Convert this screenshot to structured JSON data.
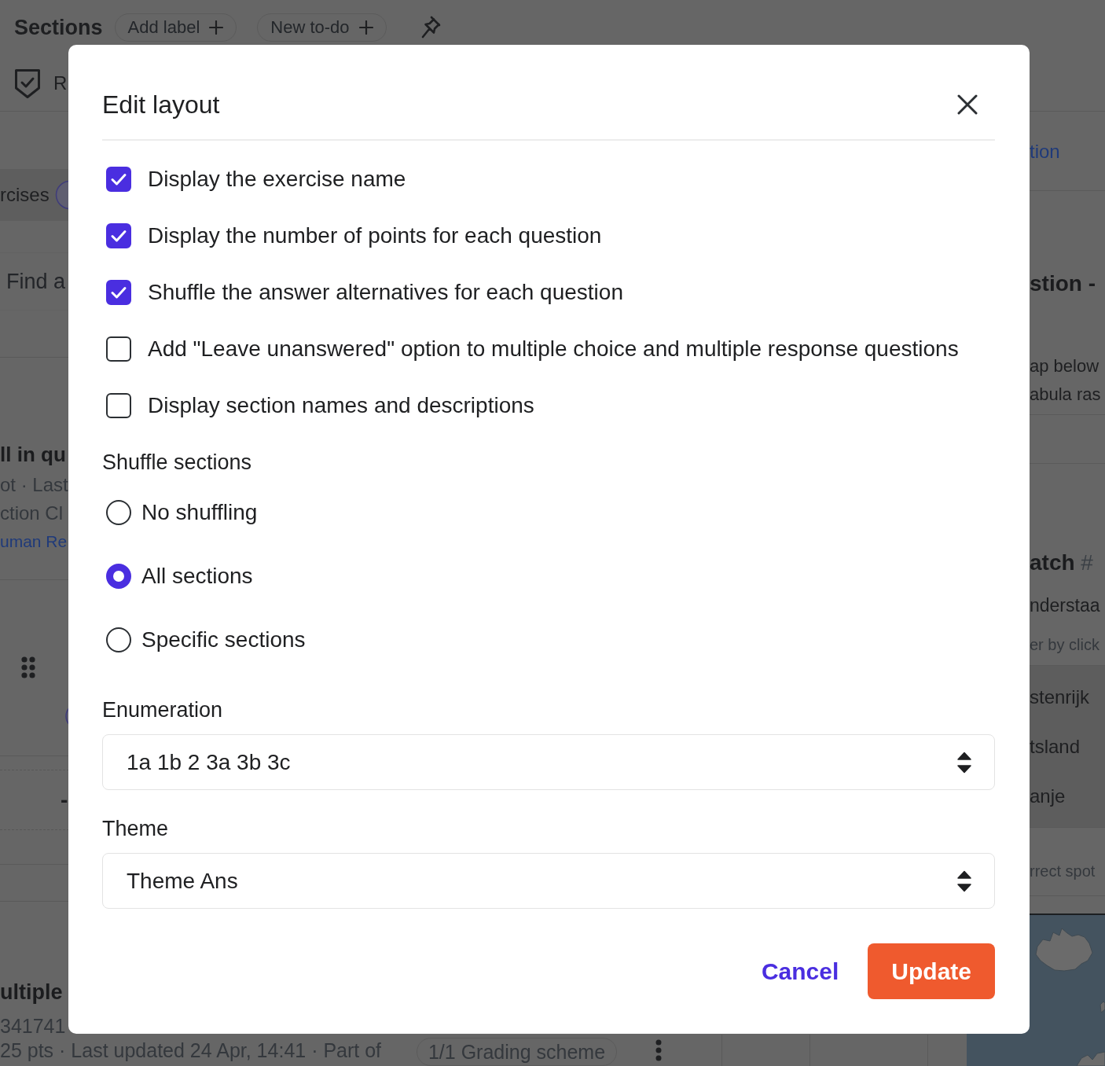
{
  "page": {
    "header": {
      "title": "Sections",
      "buttons": [
        {
          "label": "Add label"
        },
        {
          "label": "New to-do"
        }
      ]
    },
    "subheader": {
      "text": "R"
    },
    "left_panel": {
      "tab_label": "rcises",
      "search": {
        "placeholder": "Find a"
      },
      "item": {
        "title": "ll in qu",
        "meta": "ot · Last",
        "section": "ction Cl",
        "link": "uman Re"
      },
      "dash": "-",
      "item2": {
        "title": "ultiple",
        "id": "341741"
      }
    },
    "footer": {
      "meta": "25 pts · Last updated 24 Apr, 14:41 · Part of",
      "grading_button": "1/1 Grading scheme"
    },
    "right_panel": {
      "link": "tion",
      "title": "stion -",
      "lines": [
        "ap below",
        "abula ras"
      ],
      "match_title": "**atch** #",
      "instruction": "nderstaa",
      "hint": "er by click",
      "answers": [
        "stenrijk",
        "tsland",
        "anje"
      ],
      "footer_hint": "rrect spot"
    }
  },
  "dialog": {
    "title": "Edit layout",
    "options": [
      {
        "label": "Display the exercise name",
        "checked": true
      },
      {
        "label": "Display the number of points for each question",
        "checked": true
      },
      {
        "label": "Shuffle the answer alternatives for each question",
        "checked": true
      },
      {
        "label": "Add \"Leave unanswered\" option to multiple choice and multiple response questions",
        "checked": false
      },
      {
        "label": "Display section names and descriptions",
        "checked": false
      }
    ],
    "shuffle_sections": {
      "heading": "Shuffle sections",
      "options": [
        {
          "label": "No shuffling",
          "selected": false
        },
        {
          "label": "All sections",
          "selected": true
        },
        {
          "label": "Specific sections",
          "selected": false
        }
      ]
    },
    "enumeration": {
      "label": "Enumeration",
      "value": "1a 1b 2 3a 3b 3c"
    },
    "theme": {
      "label": "Theme",
      "value": "Theme Ans"
    },
    "buttons": [
      {
        "label": "Cancel",
        "kind": "link"
      },
      {
        "label": "Update",
        "kind": "primary"
      }
    ]
  }
}
